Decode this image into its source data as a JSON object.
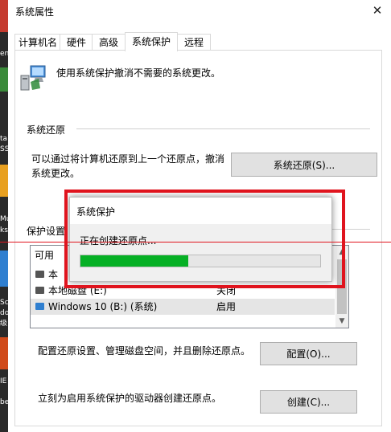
{
  "window": {
    "title": "系统属性",
    "close_glyph": "✕"
  },
  "tabs": [
    {
      "label": "计算机名",
      "active": false
    },
    {
      "label": "硬件",
      "active": false
    },
    {
      "label": "高级",
      "active": false
    },
    {
      "label": "系统保护",
      "active": true
    },
    {
      "label": "远程",
      "active": false
    }
  ],
  "intro": "使用系统保护撤消不需要的系统更改。",
  "restore": {
    "section_title": "系统还原",
    "description_line1": "可以通过将计算机还原到上一个还原点，撤消",
    "description_line2": "系统更改。",
    "button": "系统还原(S)..."
  },
  "protection": {
    "section_title": "保护设置",
    "list_header": "可用",
    "drives": [
      {
        "name": "本",
        "state": "",
        "selected": false
      },
      {
        "name": "本地磁盘 (E:)",
        "state": "关闭",
        "selected": false
      },
      {
        "name": "Windows 10 (B:) (系统)",
        "state": "启用",
        "selected": true
      }
    ]
  },
  "configure": {
    "text": "配置还原设置、管理磁盘空间，并且删除还原点。",
    "button": "配置(O)..."
  },
  "create": {
    "text": "立刻为启用系统保护的驱动器创建还原点。",
    "button": "创建(C)..."
  },
  "dialog": {
    "title": "系统保护",
    "message": "正在创建还原点...",
    "progress_fraction": 0.45
  },
  "colors": {
    "progress_fill": "#06b025",
    "highlight_red": "#e0141e",
    "button_face": "#e1e1e1"
  },
  "desktop_fragments": [
    "en",
    "ta",
    "SS",
    "Mu",
    "ks",
    "Sc",
    "do",
    "级",
    "IE",
    "be"
  ]
}
